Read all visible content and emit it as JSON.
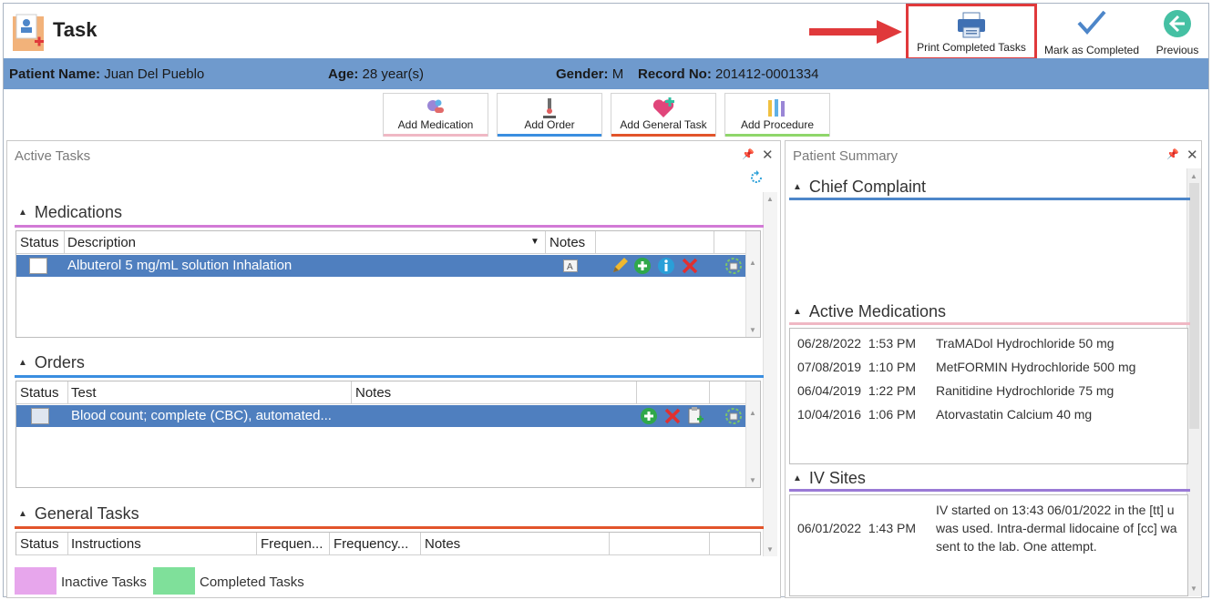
{
  "app": {
    "title": "Task"
  },
  "toolbar": {
    "print_label": "Print Completed Tasks",
    "mark_label": "Mark as Completed",
    "previous_label": "Previous"
  },
  "patient": {
    "name_label": "Patient Name:",
    "name": "Juan Del Pueblo",
    "age_label": "Age:",
    "age": "28 year(s)",
    "gender_label": "Gender:",
    "gender": "M",
    "record_label": "Record No:",
    "record": "201412-0001334"
  },
  "add_buttons": {
    "medication": "Add Medication",
    "order": "Add Order",
    "general_task": "Add General Task",
    "procedure": "Add Procedure"
  },
  "active_tasks": {
    "title": "Active Tasks",
    "medications": {
      "heading": "Medications",
      "columns": [
        "Status",
        "Description",
        "Notes"
      ],
      "rows": [
        {
          "description": "Albuterol 5 mg/mL solution Inhalation"
        }
      ]
    },
    "orders": {
      "heading": "Orders",
      "columns": [
        "Status",
        "Test",
        "Notes"
      ],
      "rows": [
        {
          "test": "Blood count; complete (CBC), automated..."
        }
      ]
    },
    "general_tasks": {
      "heading": "General Tasks",
      "columns": [
        "Status",
        "Instructions",
        "Frequen...",
        "Frequency...",
        "Notes"
      ]
    },
    "legend": {
      "inactive": "Inactive Tasks",
      "completed": "Completed Tasks"
    }
  },
  "patient_summary": {
    "title": "Patient Summary",
    "chief_complaint": {
      "heading": "Chief Complaint"
    },
    "active_medications": {
      "heading": "Active Medications",
      "rows": [
        {
          "date": "06/28/2022",
          "time": "1:53 PM",
          "name": "TraMADol Hydrochloride",
          "dose": "50 mg"
        },
        {
          "date": "07/08/2019",
          "time": "1:10 PM",
          "name": "MetFORMIN Hydrochloride",
          "dose": "500 mg"
        },
        {
          "date": "06/04/2019",
          "time": "1:22 PM",
          "name": "Ranitidine Hydrochloride",
          "dose": "75 mg"
        },
        {
          "date": "10/04/2016",
          "time": "1:06 PM",
          "name": "Atorvastatin Calcium",
          "dose": "40 mg"
        }
      ]
    },
    "iv_sites": {
      "heading": "IV Sites",
      "date": "06/01/2022",
      "time": "1:43 PM",
      "lines": [
        "IV started on 13:43 06/01/2022 in the [tt] u",
        "was used. Intra-dermal lidocaine of [cc] wa",
        "sent to the lab.  One attempt."
      ]
    }
  },
  "colors": {
    "accent_bar": "#6f9acd",
    "selected_row": "#4f7fbf",
    "medications_line": "#d27ad6",
    "orders_line": "#3a8ee0",
    "general_line": "#e2542a",
    "inactive_swatch": "#e7a6ec",
    "completed_swatch": "#7fe09a",
    "highlight": "#e0393b"
  }
}
